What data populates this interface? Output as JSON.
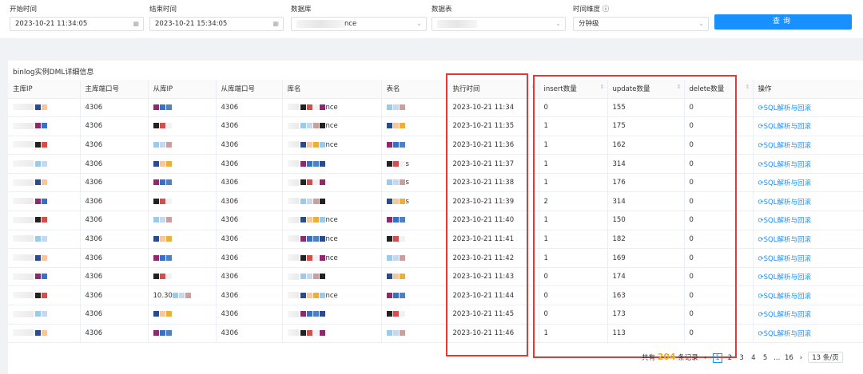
{
  "filters": {
    "start_label": "开始时间",
    "start_value": "2023-10-21 11:34:05",
    "end_label": "结束时间",
    "end_value": "2023-10-21 15:34:05",
    "db_label": "数据库",
    "db_value": "nce",
    "table_label": "数据表",
    "table_value": "",
    "dim_label": "时间维度",
    "dim_value": "分钟级",
    "query_label": "查询"
  },
  "panel_title": "binlog实例DML详细信息",
  "columns": [
    "主库IP",
    "主库端口号",
    "从库IP",
    "从库端口号",
    "库名",
    "表名",
    "执行时间",
    "insert数量",
    "update数量",
    "delete数量",
    "操作"
  ],
  "rows": [
    {
      "port": "4306",
      "sport": "4306",
      "lib": "nce",
      "tbl": "",
      "time": "2023-10-21 11:34",
      "ins": "0",
      "upd": "155",
      "del": "0",
      "op": "SQL解析与回滚",
      "sip": ""
    },
    {
      "port": "4306",
      "sport": "4306",
      "lib": "nce",
      "tbl": "",
      "time": "2023-10-21 11:35",
      "ins": "1",
      "upd": "175",
      "del": "0",
      "op": "SQL解析与回滚",
      "sip": ""
    },
    {
      "port": "4306",
      "sport": "4306",
      "lib": "nce",
      "tbl": "",
      "time": "2023-10-21 11:36",
      "ins": "1",
      "upd": "162",
      "del": "0",
      "op": "SQL解析与回滚",
      "sip": ""
    },
    {
      "port": "4306",
      "sport": "4306",
      "lib": "",
      "tbl": "s",
      "time": "2023-10-21 11:37",
      "ins": "1",
      "upd": "314",
      "del": "0",
      "op": "SQL解析与回滚",
      "sip": ""
    },
    {
      "port": "4306",
      "sport": "4306",
      "lib": "",
      "tbl": "s",
      "time": "2023-10-21 11:38",
      "ins": "1",
      "upd": "176",
      "del": "0",
      "op": "SQL解析与回滚",
      "sip": ""
    },
    {
      "port": "4306",
      "sport": "4306",
      "lib": "",
      "tbl": "s",
      "time": "2023-10-21 11:39",
      "ins": "2",
      "upd": "314",
      "del": "0",
      "op": "SQL解析与回滚",
      "sip": ""
    },
    {
      "port": "4306",
      "sport": "4306",
      "lib": "nce",
      "tbl": "",
      "time": "2023-10-21 11:40",
      "ins": "1",
      "upd": "150",
      "del": "0",
      "op": "SQL解析与回滚",
      "sip": ""
    },
    {
      "port": "4306",
      "sport": "4306",
      "lib": "nce",
      "tbl": "",
      "time": "2023-10-21 11:41",
      "ins": "1",
      "upd": "182",
      "del": "0",
      "op": "SQL解析与回滚",
      "sip": ""
    },
    {
      "port": "4306",
      "sport": "4306",
      "lib": "nce",
      "tbl": "",
      "time": "2023-10-21 11:42",
      "ins": "1",
      "upd": "169",
      "del": "0",
      "op": "SQL解析与回滚",
      "sip": ""
    },
    {
      "port": "4306",
      "sport": "4306",
      "lib": "",
      "tbl": "",
      "time": "2023-10-21 11:43",
      "ins": "0",
      "upd": "174",
      "del": "0",
      "op": "SQL解析与回滚",
      "sip": ""
    },
    {
      "port": "4306",
      "sport": "4306",
      "lib": "nce",
      "tbl": "",
      "time": "2023-10-21 11:44",
      "ins": "0",
      "upd": "163",
      "del": "0",
      "op": "SQL解析与回滚",
      "sip": "10.30"
    },
    {
      "port": "4306",
      "sport": "4306",
      "lib": "",
      "tbl": "",
      "time": "2023-10-21 11:45",
      "ins": "0",
      "upd": "173",
      "del": "0",
      "op": "SQL解析与回滚",
      "sip": ""
    },
    {
      "port": "4306",
      "sport": "4306",
      "lib": "",
      "tbl": "",
      "time": "2023-10-21 11:46",
      "ins": "1",
      "upd": "113",
      "del": "0",
      "op": "SQL解析与回滚",
      "sip": ""
    }
  ],
  "pager": {
    "prefix": "共有",
    "total": "204",
    "suffix": "条记录",
    "pages": [
      "1",
      "2",
      "3",
      "4",
      "5",
      "...",
      "16"
    ],
    "size": "13 条/页"
  },
  "accent": "#1890ff",
  "highlight": "#e53935"
}
